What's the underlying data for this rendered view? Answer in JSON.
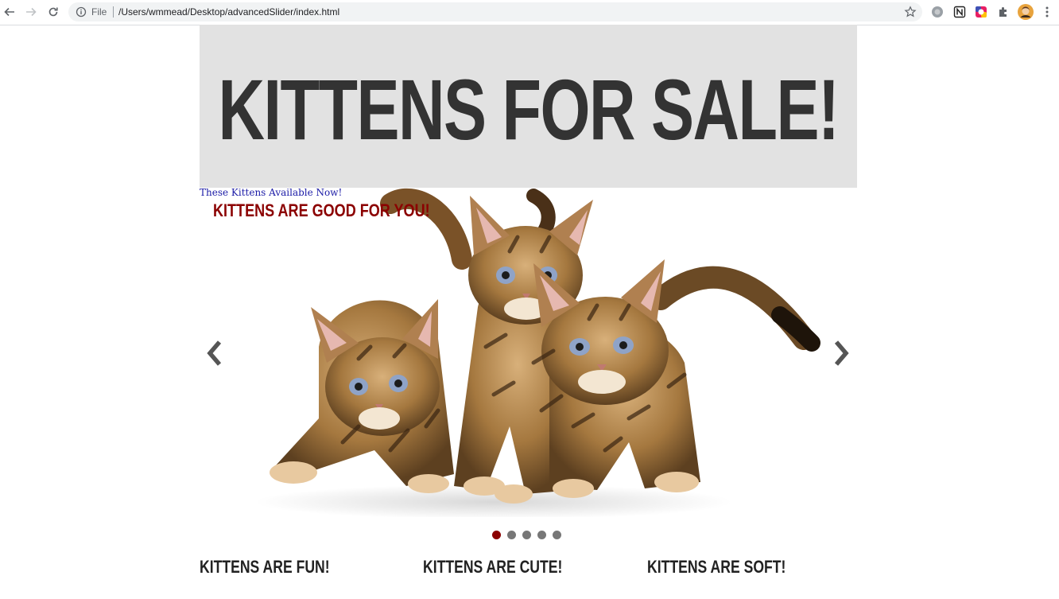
{
  "browser": {
    "file_label": "File",
    "url": "/Users/wmmead/Desktop/advancedSlider/index.html",
    "icons": [
      "back-arrow-icon",
      "forward-arrow-icon",
      "reload-icon",
      "info-icon",
      "star-icon",
      "extension-gray-icon",
      "notion-icon",
      "colorful-extension-icon",
      "puzzle-icon",
      "profile-avatar",
      "kebab-menu-icon"
    ]
  },
  "page": {
    "banner_title": "KITTENS FOR SALE!",
    "slider": {
      "caption": "These Kittens Available Now!",
      "heading": "KITTENS ARE GOOD FOR YOU!",
      "image_subject": "three tabby kittens",
      "prev_icon": "chevron-left-icon",
      "next_icon": "chevron-right-icon",
      "dot_count": 5,
      "active_dot": 1
    },
    "features": [
      "KITTENS ARE FUN!",
      "KITTENS ARE CUTE!",
      "KITTENS ARE SOFT!"
    ]
  },
  "colors": {
    "banner_bg": "#e2e2e2",
    "banner_text": "#333333",
    "accent_red": "#8b0000",
    "caption_blue": "#1a1aa6",
    "dot_inactive": "#777777"
  }
}
